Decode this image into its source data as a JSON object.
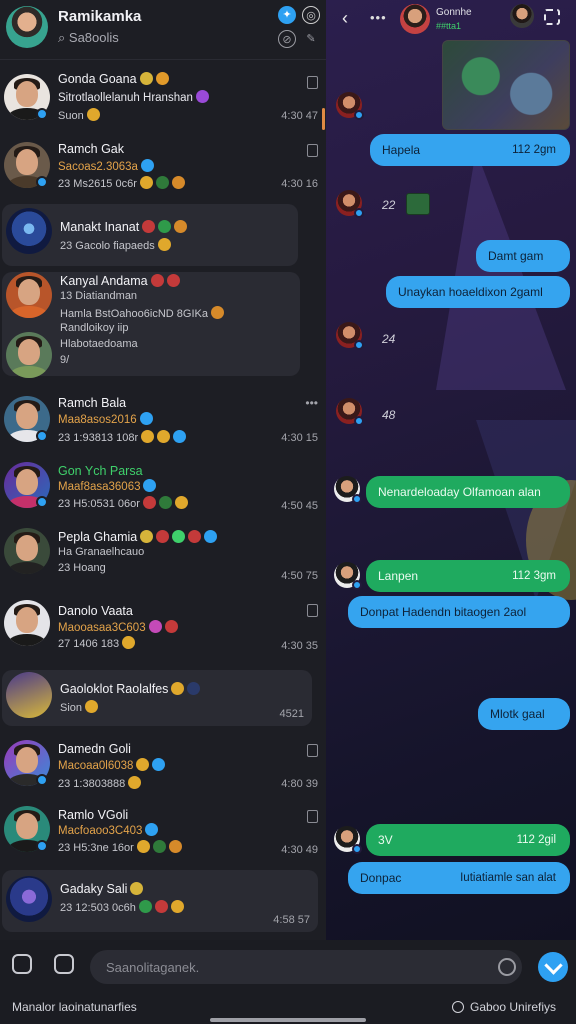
{
  "left_header": {
    "title": "Ramikamka",
    "search_label": "Sa8oolis"
  },
  "conversations": [
    {
      "name": "Gonda Goana",
      "line2": "Sitrotlaollelanuh Hranshan",
      "line3": "Suon",
      "time": "4:30 47"
    },
    {
      "name": "Ramch Gak",
      "line2": "Sacoas2.3063a",
      "line3": "23 Ms2615 0c6r",
      "time": "4:30 16"
    },
    {
      "name": "Manakt Inanat",
      "line2": "",
      "line3": "23 Gacolo fiapaeds",
      "time": ""
    },
    {
      "name": "Kanyal Andama",
      "line2": "13 Diatiandman",
      "line3": "Hamla BstOahoo6icND 8GIKa",
      "extra1": "Randloikoy iip",
      "extra2": "Hlabotaedoama",
      "extra3": "9/",
      "time": ""
    },
    {
      "name": "Ramch Bala",
      "line2": "Maa8asos2016",
      "line3": "23 1:93813 108r",
      "time": "4:30 15"
    },
    {
      "name": "Gon Ych Parsa",
      "line2": "Maaf8asa36063",
      "line3": "23 H5:0531 06or",
      "time": "4:50 45"
    },
    {
      "name": "Pepla Ghamia",
      "line2": "Ha Granaelhcauo",
      "line3": "23 Hoang",
      "time": "4:50 75"
    },
    {
      "name": "Danolo Vaata",
      "line2": "Maooasaa3C603",
      "line3": "27 1406 183",
      "time": "4:30 35"
    },
    {
      "name": "Gaoloklot Raolalfes",
      "line2": "",
      "line3": "Sion",
      "time": "4521"
    },
    {
      "name": "Damedn Goli",
      "line2": "Macoaa0l6038",
      "line3": "23 1:3803888",
      "time": "4:80 39"
    },
    {
      "name": "Ramlo VGoli",
      "line2": "Macfoaoo3C403",
      "line3": "23 H5:3ne 16or",
      "time": "4:30 49"
    },
    {
      "name": "Gadaky Sali",
      "line2": "",
      "line3": "23 12:503 0c6h",
      "time": "4:58 57"
    }
  ],
  "chat_header": {
    "contact_name": "Gonnhe",
    "contact_status": "##tta1"
  },
  "messages": [
    {
      "kind": "bubble",
      "text": "Hapela",
      "time": "112 2gm"
    },
    {
      "kind": "count",
      "text": "22"
    },
    {
      "kind": "bubble",
      "text": "Damt gam"
    },
    {
      "kind": "bubble",
      "text": "Unaykan  hoaeldixon 2gaml"
    },
    {
      "kind": "count",
      "text": "24"
    },
    {
      "kind": "count",
      "text": "48"
    },
    {
      "kind": "bubble",
      "text": "Nenardeloaday Olfamoan alan"
    },
    {
      "kind": "bubble",
      "text": "Lanpen",
      "time": "112 3gm"
    },
    {
      "kind": "bubble",
      "text": "Donpat   Hadendn bitaogen 2aol"
    },
    {
      "kind": "bubble",
      "text": "Mlotk gaal"
    },
    {
      "kind": "bubble",
      "text": "3V",
      "time": "112 2gil"
    },
    {
      "kind": "bubble",
      "text": "Donpac",
      "text2": "Iutiatiamle san alat"
    }
  ],
  "composer": {
    "placeholder": "Saanolitaganek."
  },
  "footer": {
    "left": "Manalor laoinatunarfies",
    "right": "Gaboo Unirefiys"
  },
  "colors": {
    "accent_blue": "#35a4ef",
    "accent_green": "#1faa5f",
    "highlight_orange": "#e3a34a"
  }
}
